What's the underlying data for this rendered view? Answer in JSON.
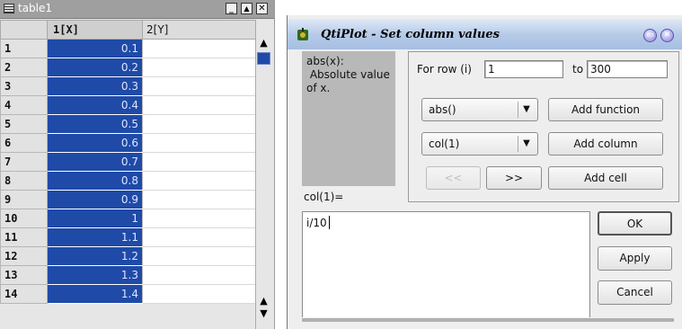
{
  "table_window": {
    "title": "table1",
    "controls": {
      "minimize": "_",
      "maximize": "▲",
      "close": "✕"
    },
    "columns": [
      "1[X]",
      "2[Y]"
    ],
    "rows": [
      {
        "row": "1",
        "x": "0.1",
        "y": ""
      },
      {
        "row": "2",
        "x": "0.2",
        "y": ""
      },
      {
        "row": "3",
        "x": "0.3",
        "y": ""
      },
      {
        "row": "4",
        "x": "0.4",
        "y": ""
      },
      {
        "row": "5",
        "x": "0.5",
        "y": ""
      },
      {
        "row": "6",
        "x": "0.6",
        "y": ""
      },
      {
        "row": "7",
        "x": "0.7",
        "y": ""
      },
      {
        "row": "8",
        "x": "0.8",
        "y": ""
      },
      {
        "row": "9",
        "x": "0.9",
        "y": ""
      },
      {
        "row": "10",
        "x": "1",
        "y": ""
      },
      {
        "row": "11",
        "x": "1.1",
        "y": ""
      },
      {
        "row": "12",
        "x": "1.2",
        "y": ""
      },
      {
        "row": "13",
        "x": "1.3",
        "y": ""
      },
      {
        "row": "14",
        "x": "1.4",
        "y": ""
      }
    ],
    "selected_column_color": "#1f4aa8",
    "scroll_up_icon": "arrow-up-icon",
    "scroll_down_icon": "arrow-down-icon"
  },
  "dialog": {
    "title": "QtiPlot - Set column values",
    "help_text": "abs(x):\n Absolute value of x.",
    "for_row_label": "For row (i)",
    "row_from": "1",
    "to_label": "to",
    "row_to": "300",
    "function_combo": "abs()",
    "add_function": "Add function",
    "column_combo": "col(1)",
    "add_column": "Add column",
    "prev_button": "<<",
    "next_button": ">>",
    "add_cell": "Add cell",
    "column_equation_label": "col(1)=",
    "formula": "i/10",
    "ok": "OK",
    "apply": "Apply",
    "cancel": "Cancel",
    "titlebar_color": "#b7cbe8"
  }
}
